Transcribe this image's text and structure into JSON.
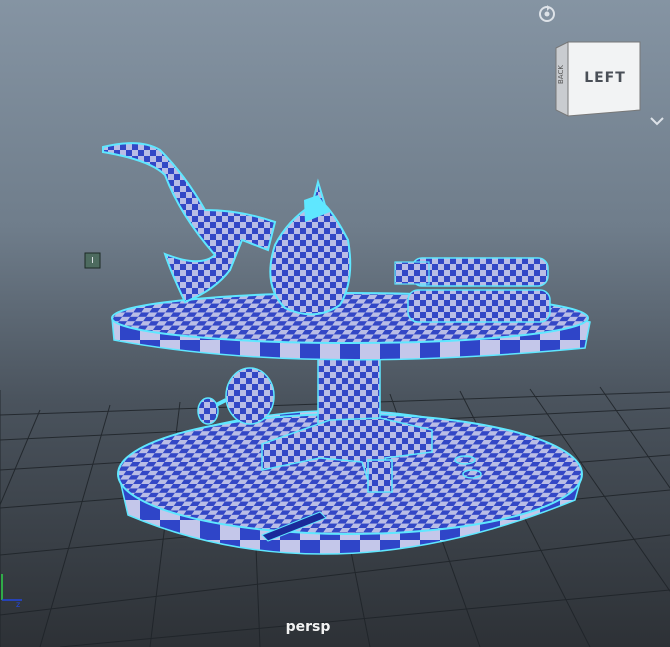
{
  "viewport": {
    "camera_name": "persp",
    "view_cube_face": "LEFT",
    "view_cube_side_face": "BACK"
  },
  "icons": {
    "home": "home-rotate-icon",
    "menu": "chevron-down-icon",
    "marker": "pivot-marker-icon",
    "axis": "axis-gizmo-icon"
  },
  "colors": {
    "checker_dark": "#3347c6",
    "checker_light": "#b9bde6",
    "wire": "#5fe7ff",
    "grid": "#1e2328",
    "bg_top": "#8594a3",
    "bg_bottom": "#2d3136"
  }
}
